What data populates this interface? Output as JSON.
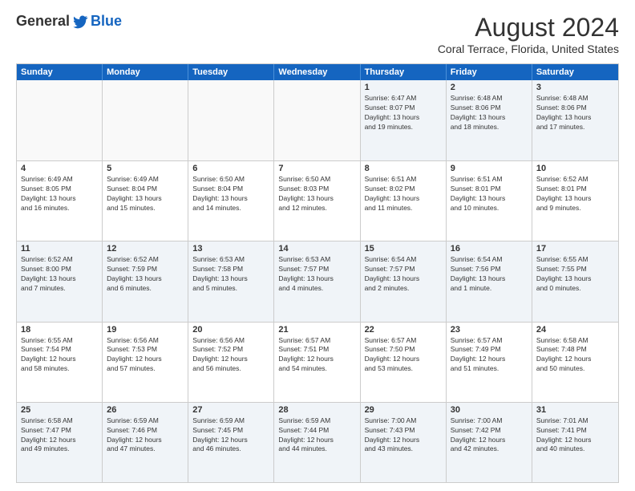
{
  "logo": {
    "general": "General",
    "blue": "Blue"
  },
  "title": {
    "month_year": "August 2024",
    "location": "Coral Terrace, Florida, United States"
  },
  "calendar": {
    "headers": [
      "Sunday",
      "Monday",
      "Tuesday",
      "Wednesday",
      "Thursday",
      "Friday",
      "Saturday"
    ],
    "rows": [
      [
        {
          "day": "",
          "info": "",
          "empty": true
        },
        {
          "day": "",
          "info": "",
          "empty": true
        },
        {
          "day": "",
          "info": "",
          "empty": true
        },
        {
          "day": "",
          "info": "",
          "empty": true
        },
        {
          "day": "1",
          "info": "Sunrise: 6:47 AM\nSunset: 8:07 PM\nDaylight: 13 hours\nand 19 minutes."
        },
        {
          "day": "2",
          "info": "Sunrise: 6:48 AM\nSunset: 8:06 PM\nDaylight: 13 hours\nand 18 minutes."
        },
        {
          "day": "3",
          "info": "Sunrise: 6:48 AM\nSunset: 8:06 PM\nDaylight: 13 hours\nand 17 minutes."
        }
      ],
      [
        {
          "day": "4",
          "info": "Sunrise: 6:49 AM\nSunset: 8:05 PM\nDaylight: 13 hours\nand 16 minutes."
        },
        {
          "day": "5",
          "info": "Sunrise: 6:49 AM\nSunset: 8:04 PM\nDaylight: 13 hours\nand 15 minutes."
        },
        {
          "day": "6",
          "info": "Sunrise: 6:50 AM\nSunset: 8:04 PM\nDaylight: 13 hours\nand 14 minutes."
        },
        {
          "day": "7",
          "info": "Sunrise: 6:50 AM\nSunset: 8:03 PM\nDaylight: 13 hours\nand 12 minutes."
        },
        {
          "day": "8",
          "info": "Sunrise: 6:51 AM\nSunset: 8:02 PM\nDaylight: 13 hours\nand 11 minutes."
        },
        {
          "day": "9",
          "info": "Sunrise: 6:51 AM\nSunset: 8:01 PM\nDaylight: 13 hours\nand 10 minutes."
        },
        {
          "day": "10",
          "info": "Sunrise: 6:52 AM\nSunset: 8:01 PM\nDaylight: 13 hours\nand 9 minutes."
        }
      ],
      [
        {
          "day": "11",
          "info": "Sunrise: 6:52 AM\nSunset: 8:00 PM\nDaylight: 13 hours\nand 7 minutes."
        },
        {
          "day": "12",
          "info": "Sunrise: 6:52 AM\nSunset: 7:59 PM\nDaylight: 13 hours\nand 6 minutes."
        },
        {
          "day": "13",
          "info": "Sunrise: 6:53 AM\nSunset: 7:58 PM\nDaylight: 13 hours\nand 5 minutes."
        },
        {
          "day": "14",
          "info": "Sunrise: 6:53 AM\nSunset: 7:57 PM\nDaylight: 13 hours\nand 4 minutes."
        },
        {
          "day": "15",
          "info": "Sunrise: 6:54 AM\nSunset: 7:57 PM\nDaylight: 13 hours\nand 2 minutes."
        },
        {
          "day": "16",
          "info": "Sunrise: 6:54 AM\nSunset: 7:56 PM\nDaylight: 13 hours\nand 1 minute."
        },
        {
          "day": "17",
          "info": "Sunrise: 6:55 AM\nSunset: 7:55 PM\nDaylight: 13 hours\nand 0 minutes."
        }
      ],
      [
        {
          "day": "18",
          "info": "Sunrise: 6:55 AM\nSunset: 7:54 PM\nDaylight: 12 hours\nand 58 minutes."
        },
        {
          "day": "19",
          "info": "Sunrise: 6:56 AM\nSunset: 7:53 PM\nDaylight: 12 hours\nand 57 minutes."
        },
        {
          "day": "20",
          "info": "Sunrise: 6:56 AM\nSunset: 7:52 PM\nDaylight: 12 hours\nand 56 minutes."
        },
        {
          "day": "21",
          "info": "Sunrise: 6:57 AM\nSunset: 7:51 PM\nDaylight: 12 hours\nand 54 minutes."
        },
        {
          "day": "22",
          "info": "Sunrise: 6:57 AM\nSunset: 7:50 PM\nDaylight: 12 hours\nand 53 minutes."
        },
        {
          "day": "23",
          "info": "Sunrise: 6:57 AM\nSunset: 7:49 PM\nDaylight: 12 hours\nand 51 minutes."
        },
        {
          "day": "24",
          "info": "Sunrise: 6:58 AM\nSunset: 7:48 PM\nDaylight: 12 hours\nand 50 minutes."
        }
      ],
      [
        {
          "day": "25",
          "info": "Sunrise: 6:58 AM\nSunset: 7:47 PM\nDaylight: 12 hours\nand 49 minutes."
        },
        {
          "day": "26",
          "info": "Sunrise: 6:59 AM\nSunset: 7:46 PM\nDaylight: 12 hours\nand 47 minutes."
        },
        {
          "day": "27",
          "info": "Sunrise: 6:59 AM\nSunset: 7:45 PM\nDaylight: 12 hours\nand 46 minutes."
        },
        {
          "day": "28",
          "info": "Sunrise: 6:59 AM\nSunset: 7:44 PM\nDaylight: 12 hours\nand 44 minutes."
        },
        {
          "day": "29",
          "info": "Sunrise: 7:00 AM\nSunset: 7:43 PM\nDaylight: 12 hours\nand 43 minutes."
        },
        {
          "day": "30",
          "info": "Sunrise: 7:00 AM\nSunset: 7:42 PM\nDaylight: 12 hours\nand 42 minutes."
        },
        {
          "day": "31",
          "info": "Sunrise: 7:01 AM\nSunset: 7:41 PM\nDaylight: 12 hours\nand 40 minutes."
        }
      ]
    ]
  }
}
